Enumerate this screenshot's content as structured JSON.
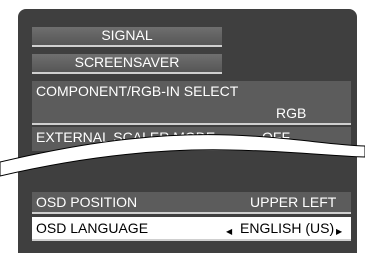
{
  "menu": {
    "signal_label": "SIGNAL",
    "screensaver_label": "SCREENSAVER",
    "component_rgb_label": "COMPONENT/RGB-IN SELECT",
    "component_rgb_value": "RGB",
    "external_scaler_label": "EXTERNAL SCALER MODE",
    "external_scaler_value": "OFF",
    "osd_position_label": "OSD POSITION",
    "osd_position_value": "UPPER LEFT",
    "osd_language_label": "OSD LANGUAGE",
    "osd_language_value": "ENGLISH (US)"
  },
  "icons": {
    "left_arrow": "◀",
    "right_arrow": "▶"
  },
  "colors": {
    "panel": "#3f3f3f",
    "button": "#606060",
    "highlight": "#ffffff"
  }
}
